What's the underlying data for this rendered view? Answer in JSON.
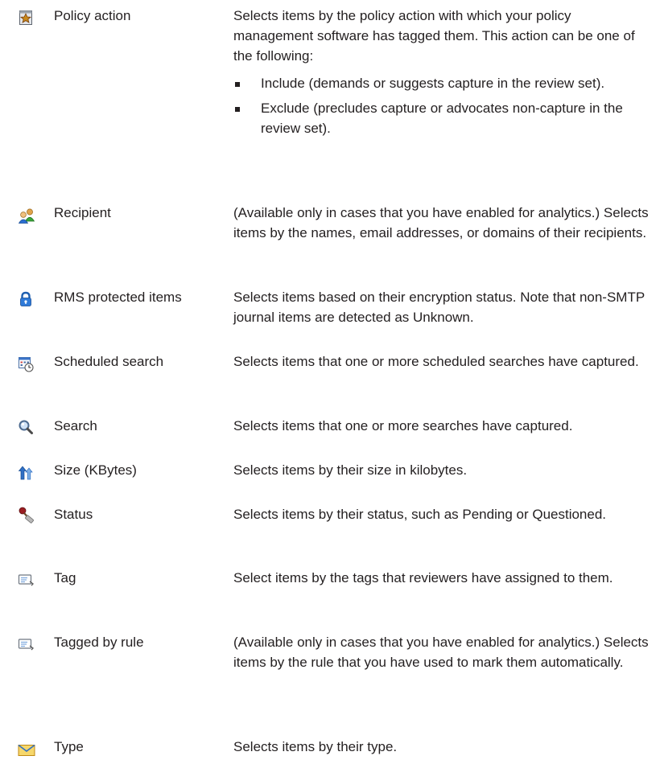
{
  "rows": [
    {
      "icon": "policy-star-icon",
      "name": "Policy action",
      "description": "Selects items by the policy action with which your policy management software has tagged them. This action can be one of the following:",
      "bullets": [
        "Include (demands or suggests capture in the review set).",
        "Exclude (precludes capture or advocates non-capture in the review set)."
      ]
    },
    {
      "icon": "recipients-people-icon",
      "name": "Recipient",
      "description": "(Available only in cases that you have enabled for analytics.) Selects items by the names, email addresses, or domains of their recipients."
    },
    {
      "icon": "rms-lock-icon",
      "name": "RMS protected items",
      "description": "Selects items based on their encryption status. Note that non-SMTP journal items are detected as Unknown."
    },
    {
      "icon": "scheduled-search-calendar-clock-icon",
      "name": "Scheduled search",
      "description": "Selects items that one or more scheduled searches have captured."
    },
    {
      "icon": "magnifier-icon",
      "name": "Search",
      "description": "Selects items that one or more searches have captured."
    },
    {
      "icon": "size-arrows-icon",
      "name": "Size (KBytes)",
      "description": "Selects items by their size in kilobytes."
    },
    {
      "icon": "status-stamp-icon",
      "name": "Status",
      "description": "Selects items by their status, such as Pending or Questioned."
    },
    {
      "icon": "tag-icon",
      "name": "Tag",
      "description": "Select items by the tags that reviewers have assigned to them."
    },
    {
      "icon": "tag-rule-icon",
      "name": "Tagged by rule",
      "description": "(Available only in cases that you have enabled for analytics.) Selects items by the rule that you have used to mark them automatically."
    },
    {
      "icon": "envelope-icon",
      "name": "Type",
      "description": "Selects items by their type."
    }
  ]
}
